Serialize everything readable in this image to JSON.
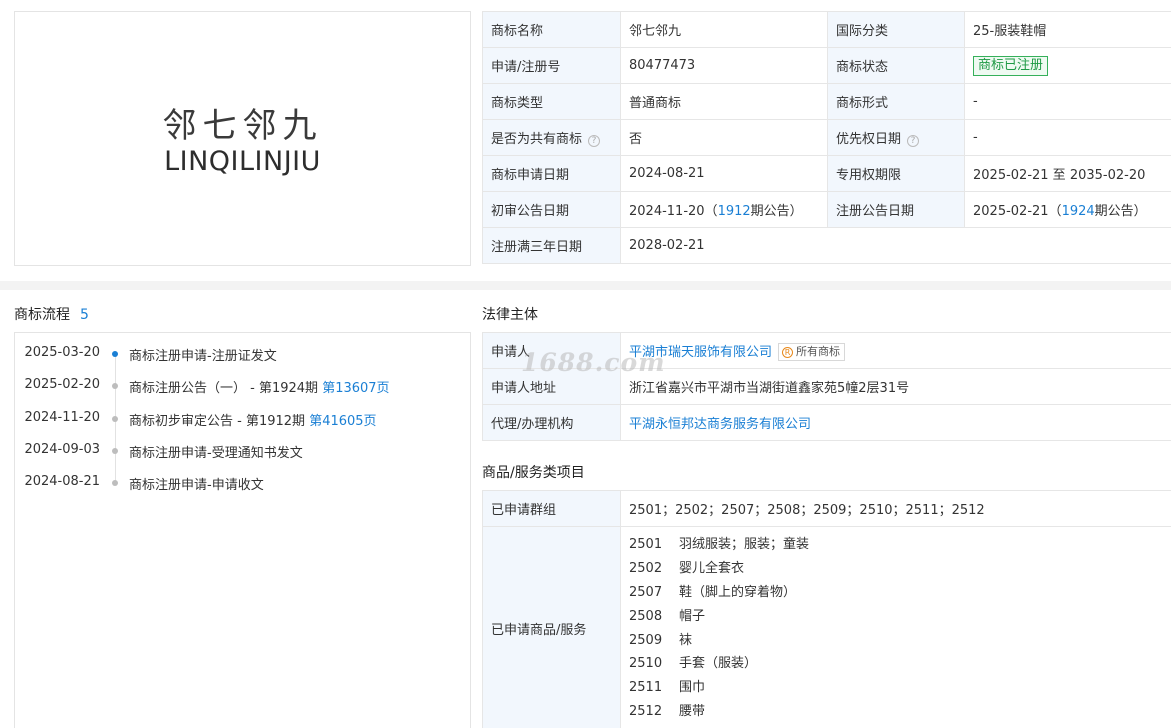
{
  "logo": {
    "cn": "邻七邻九",
    "en": "LINQILINJIU"
  },
  "info": {
    "name_label": "商标名称",
    "name_value": "邻七邻九",
    "class_label": "国际分类",
    "class_value": "25-服装鞋帽",
    "regno_label": "申请/注册号",
    "regno_value": "80477473",
    "status_label": "商标状态",
    "status_value": "商标已注册",
    "type_label": "商标类型",
    "type_value": "普通商标",
    "form_label": "商标形式",
    "form_value": "-",
    "shared_label": "是否为共有商标",
    "shared_value": "否",
    "priority_label": "优先权日期",
    "priority_value": "-",
    "apply_date_label": "商标申请日期",
    "apply_date_value": "2024-08-21",
    "exclusive_label": "专用权期限",
    "exclusive_value": "2025-02-21 至 2035-02-20",
    "prelim_label": "初审公告日期",
    "prelim_date": "2024-11-20（",
    "prelim_issue": "1912",
    "prelim_suffix": "期公告）",
    "regpub_label": "注册公告日期",
    "regpub_date": "2025-02-21（",
    "regpub_issue": "1924",
    "regpub_suffix": "期公告）",
    "three_year_label": "注册满三年日期",
    "three_year_value": "2028-02-21",
    "help_glyph": "?"
  },
  "flow": {
    "title": "商标流程",
    "count": "5",
    "items": [
      {
        "date": "2025-03-20",
        "text": "商标注册申请-注册证发文",
        "link": ""
      },
      {
        "date": "2025-02-20",
        "text": "商标注册公告（一） - 第1924期 ",
        "link": "第13607页"
      },
      {
        "date": "2024-11-20",
        "text": "商标初步审定公告 - 第1912期 ",
        "link": "第41605页"
      },
      {
        "date": "2024-09-03",
        "text": "商标注册申请-受理通知书发文",
        "link": ""
      },
      {
        "date": "2024-08-21",
        "text": "商标注册申请-申请收文",
        "link": ""
      }
    ]
  },
  "legal": {
    "title": "法律主体",
    "applicant_label": "申请人",
    "applicant_value": "平湖市瑞天服饰有限公司",
    "all_tm_glyph": "R",
    "all_tm_label": "所有商标",
    "address_label": "申请人地址",
    "address_value": "浙江省嘉兴市平湖市当湖街道鑫家苑5幢2层31号",
    "agent_label": "代理/办理机构",
    "agent_value": "平湖永恒邦达商务服务有限公司"
  },
  "watermark": "1688.com",
  "goods": {
    "title": "商品/服务类项目",
    "groups_label": "已申请群组",
    "groups_value": "2501；2502；2507；2508；2509；2510；2511；2512",
    "items_label": "已申请商品/服务",
    "items": [
      {
        "code": "2501",
        "name": "羽绒服装；服装；童装"
      },
      {
        "code": "2502",
        "name": "婴儿全套衣"
      },
      {
        "code": "2507",
        "name": "鞋（脚上的穿着物）"
      },
      {
        "code": "2508",
        "name": "帽子"
      },
      {
        "code": "2509",
        "name": "袜"
      },
      {
        "code": "2510",
        "name": "手套（服装）"
      },
      {
        "code": "2511",
        "name": "围巾"
      },
      {
        "code": "2512",
        "name": "腰带"
      }
    ]
  },
  "colors": {
    "link": "#1a7fd4",
    "label_bg": "#f2f7fd",
    "status_green": "#1f9a45",
    "active_dot": "#1a7fd4"
  }
}
